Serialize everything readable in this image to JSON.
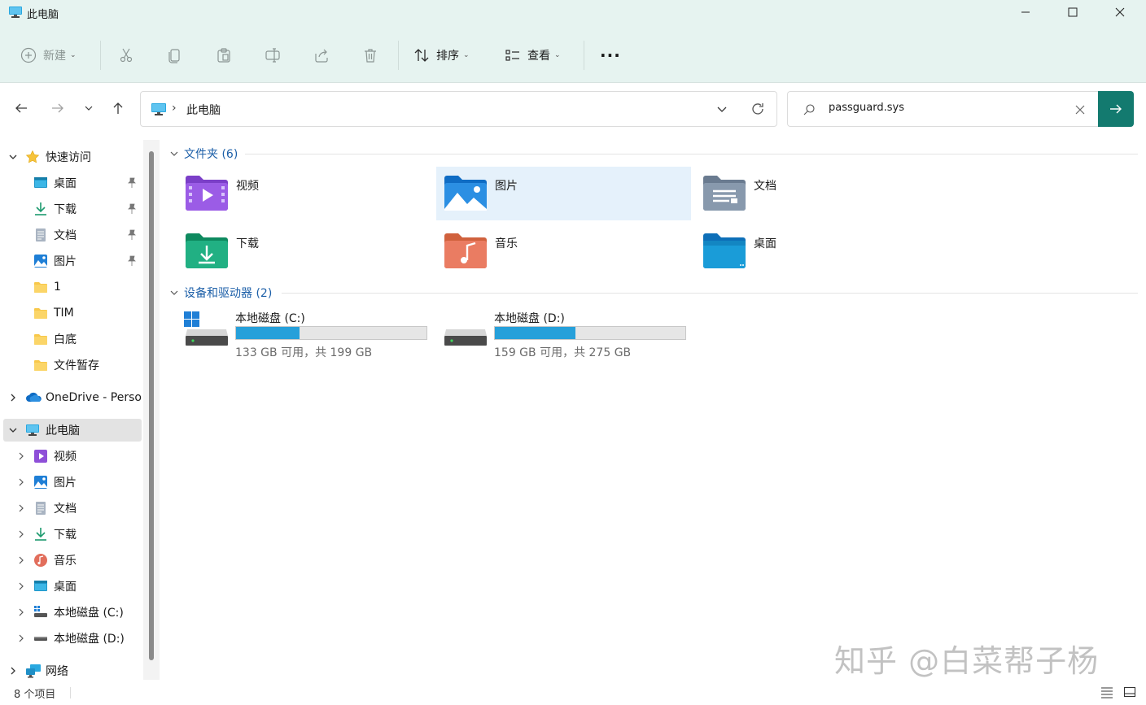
{
  "window": {
    "title": "此电脑"
  },
  "toolbar": {
    "new_label": "新建",
    "sort_label": "排序",
    "view_label": "查看",
    "more_label": "···"
  },
  "address": {
    "crumb": "此电脑"
  },
  "search": {
    "value": "passguard.sys"
  },
  "sidebar": {
    "quick_access": "快速访问",
    "pinned": [
      {
        "label": "桌面",
        "icon": "desktop-icon"
      },
      {
        "label": "下载",
        "icon": "download-icon"
      },
      {
        "label": "文档",
        "icon": "document-icon"
      },
      {
        "label": "图片",
        "icon": "picture-icon"
      }
    ],
    "folders": [
      {
        "label": "1",
        "icon": "folder-icon"
      },
      {
        "label": "TIM",
        "icon": "folder-icon"
      },
      {
        "label": "白底",
        "icon": "folder-icon"
      },
      {
        "label": "文件暂存",
        "icon": "folder-icon"
      }
    ],
    "onedrive": "OneDrive - Perso",
    "this_pc": "此电脑",
    "pc_items": [
      {
        "label": "视频",
        "icon": "video-icon"
      },
      {
        "label": "图片",
        "icon": "picture-icon"
      },
      {
        "label": "文档",
        "icon": "document-icon"
      },
      {
        "label": "下载",
        "icon": "download-icon"
      },
      {
        "label": "音乐",
        "icon": "music-icon"
      },
      {
        "label": "桌面",
        "icon": "desktop-icon"
      },
      {
        "label": "本地磁盘 (C:)",
        "icon": "windows-drive-icon"
      },
      {
        "label": "本地磁盘 (D:)",
        "icon": "drive-icon"
      }
    ],
    "network": "网络"
  },
  "main": {
    "folders_header": "文件夹 (6)",
    "folders": [
      {
        "name": "视频",
        "icon": "video-folder-icon"
      },
      {
        "name": "图片",
        "icon": "pictures-folder-icon"
      },
      {
        "name": "文档",
        "icon": "documents-folder-icon"
      },
      {
        "name": "下载",
        "icon": "downloads-folder-icon"
      },
      {
        "name": "音乐",
        "icon": "music-folder-icon"
      },
      {
        "name": "桌面",
        "icon": "desktop-folder-icon"
      }
    ],
    "drives_header": "设备和驱动器 (2)",
    "drives": [
      {
        "name": "本地磁盘 (C:)",
        "free_text": "133 GB 可用，共 199 GB",
        "used_fraction": 0.332
      },
      {
        "name": "本地磁盘 (D:)",
        "free_text": "159 GB 可用，共 275 GB",
        "used_fraction": 0.422
      }
    ]
  },
  "status": {
    "count": "8 个项目"
  },
  "watermark": "知乎 @白菜帮子杨",
  "colors": {
    "accent": "#137a6f",
    "group_header": "#1c5fa8",
    "drive_fill": "#26a0da",
    "selection": "#e5f1fb"
  }
}
